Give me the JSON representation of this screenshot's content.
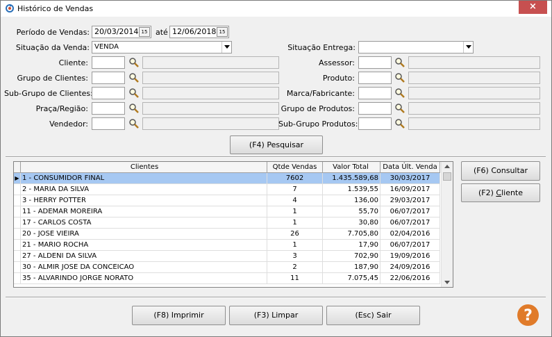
{
  "window": {
    "title": "Histórico de Vendas",
    "close_glyph": "×"
  },
  "filters": {
    "periodo_label": "Período de Vendas:",
    "date_from": "20/03/2014",
    "ate_label": "até",
    "date_to": "12/06/2018",
    "date_btn_glyph": "15",
    "situacao_venda_label": "Situação da Venda:",
    "situacao_venda_value": "VENDA",
    "situacao_entrega_label": "Situação Entrega:",
    "situacao_entrega_value": "",
    "left_fields": [
      {
        "label": "Cliente:",
        "code": "",
        "desc": ""
      },
      {
        "label": "Grupo de Clientes:",
        "code": "",
        "desc": ""
      },
      {
        "label": "Sub-Grupo de Clientes:",
        "code": "",
        "desc": ""
      },
      {
        "label": "Praça/Região:",
        "code": "",
        "desc": ""
      },
      {
        "label": "Vendedor:",
        "code": "",
        "desc": ""
      }
    ],
    "right_fields": [
      {
        "label": "Assessor:",
        "code": "",
        "desc": ""
      },
      {
        "label": "Produto:",
        "code": "",
        "desc": ""
      },
      {
        "label": "Marca/Fabricante:",
        "code": "",
        "desc": ""
      },
      {
        "label": "Grupo de Produtos:",
        "code": "",
        "desc": ""
      },
      {
        "label": "Sub-Grupo Produtos:",
        "code": "",
        "desc": ""
      }
    ]
  },
  "buttons": {
    "pesquisar": "(F4) Pesquisar",
    "consultar": "(F6) Consultar",
    "cliente_prefix": "(F2) ",
    "cliente_accel": "C",
    "cliente_rest": "liente",
    "imprimir": "(F8) Imprimir",
    "limpar": "(F3) Limpar",
    "sair": "(Esc) Sair",
    "help": "?"
  },
  "table": {
    "columns": [
      "Clientes",
      "Qtde Vendas",
      "Valor Total",
      "Data Últ. Venda"
    ],
    "selected_indicator": "▶",
    "rows": [
      {
        "cliente": "1 - CONSUMIDOR FINAL",
        "qtde": "7602",
        "valor": "1.435.589,68",
        "data": "30/03/2017"
      },
      {
        "cliente": "2 - MARIA DA SILVA",
        "qtde": "7",
        "valor": "1.539,55",
        "data": "16/09/2017"
      },
      {
        "cliente": "3 - HERRY POTTER",
        "qtde": "4",
        "valor": "136,00",
        "data": "29/03/2017"
      },
      {
        "cliente": "11 - ADEMAR MOREIRA",
        "qtde": "1",
        "valor": "55,70",
        "data": "06/07/2017"
      },
      {
        "cliente": "17 - CARLOS COSTA",
        "qtde": "1",
        "valor": "30,80",
        "data": "06/07/2017"
      },
      {
        "cliente": "20 - JOSE VIEIRA",
        "qtde": "26",
        "valor": "7.705,80",
        "data": "02/04/2016"
      },
      {
        "cliente": "21 - MARIO ROCHA",
        "qtde": "1",
        "valor": "17,90",
        "data": "06/07/2017"
      },
      {
        "cliente": "27 - ALDENI DA SILVA",
        "qtde": "3",
        "valor": "702,90",
        "data": "19/09/2016"
      },
      {
        "cliente": "30 - ALMIR JOSE DA CONCEICAO",
        "qtde": "2",
        "valor": "187,90",
        "data": "24/09/2016"
      },
      {
        "cliente": "35 - ALVARINDO JORGE NORATO",
        "qtde": "11",
        "valor": "7.075,45",
        "data": "22/06/2016"
      }
    ]
  },
  "colors": {
    "selected_row": "#a6c8f2",
    "close_button": "#c75050",
    "help_orange": "#e07b2a"
  }
}
